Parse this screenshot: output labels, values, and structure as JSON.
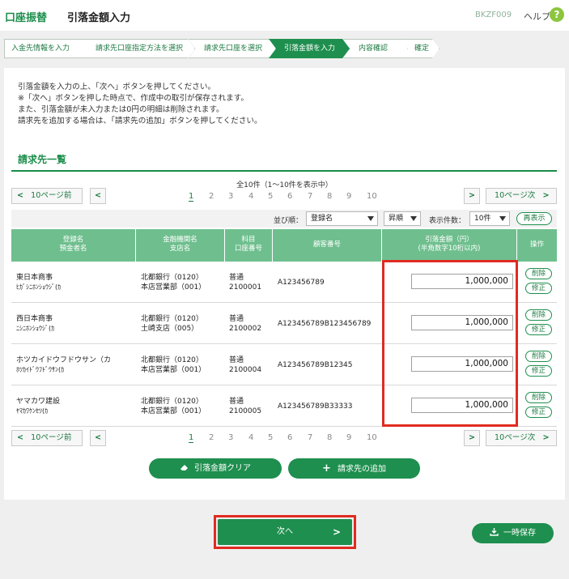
{
  "header": {
    "service": "口座振替",
    "title": "引落金額入力",
    "screen_code": "BKZF009",
    "help_label": "ヘルプ",
    "help_icon": "?"
  },
  "breadcrumbs": [
    "入金先情報を入力",
    "請求先口座指定方法を選択",
    "請求先口座を選択",
    "引落金額を入力",
    "内容確認",
    "確定"
  ],
  "intro": [
    "引落金額を入力の上、「次へ」ボタンを押してください。",
    "※「次へ」ボタンを押した時点で、作成中の取引が保存されます。",
    "また、引落金額が未入力または0円の明細は削除されます。",
    "請求先を追加する場合は、「請求先の追加」ボタンを押してください。"
  ],
  "section_title": "請求先一覧",
  "total_text": "全10件（1～10件を表示中）",
  "pagination": {
    "prev10": "10ページ前",
    "next10": "10ページ次",
    "pages": [
      "1",
      "2",
      "3",
      "4",
      "5",
      "6",
      "7",
      "8",
      "9",
      "10"
    ],
    "current": "1"
  },
  "sort": {
    "sort_label": "並び順：",
    "sort_value": "登録名",
    "order_value": "昇順",
    "count_label": "表示件数：",
    "count_value": "10件",
    "redisplay": "再表示"
  },
  "table": {
    "headers": [
      [
        "登録名",
        "預金者名"
      ],
      [
        "金融機関名",
        "支店名"
      ],
      [
        "科目",
        "口座番号"
      ],
      [
        "顧客番号"
      ],
      [
        "引落金額（円）",
        "(半角数字10桁以内)"
      ],
      [
        "操作"
      ]
    ],
    "rows": [
      {
        "name": "東日本商事",
        "kana": "ﾋｶﾞｼﾆﾎﾝｼｮｳｼﾞ(ｶ",
        "bank": "北都銀行（0120）",
        "branch": "本店営業部（001）",
        "type": "普通",
        "account": "2100001",
        "customer": "A123456789",
        "amount": "1,000,000"
      },
      {
        "name": "西日本商事",
        "kana": "ﾆｼﾆﾎﾝｼｮｳｼﾞ(ｶ",
        "bank": "北都銀行（0120）",
        "branch": "土崎支店（005）",
        "type": "普通",
        "account": "2100002",
        "customer": "A123456789B123456789",
        "amount": "1,000,000"
      },
      {
        "name": "ホツカイドウフドウサン（カ",
        "kana": "ﾎﾂｶｲﾄﾞｳﾌﾄﾞｳｻﾝ(ｶ",
        "bank": "北都銀行（0120）",
        "branch": "本店営業部（001）",
        "type": "普通",
        "account": "2100004",
        "customer": "A123456789B12345",
        "amount": "1,000,000"
      },
      {
        "name": "ヤマカワ建設",
        "kana": "ﾔﾏｶﾜｹﾝｾﾂ(ｶ",
        "bank": "北都銀行（0120）",
        "branch": "本店営業部（001）",
        "type": "普通",
        "account": "2100005",
        "customer": "A123456789B33333",
        "amount": "1,000,000"
      }
    ],
    "delete_label": "削除",
    "edit_label": "修正"
  },
  "buttons": {
    "clear": "引落金額クリア",
    "add": "請求先の追加",
    "next": "次へ",
    "save": "一時保存"
  },
  "colors": {
    "brand_green": "#1e8f4e",
    "header_green": "#6fbf8e",
    "highlight_red": "#e02b20"
  },
  "icons": [
    "help-icon",
    "chevron-left-icon",
    "chevron-right-icon",
    "eraser-icon",
    "plus-icon",
    "download-icon",
    "dropdown-icon"
  ]
}
